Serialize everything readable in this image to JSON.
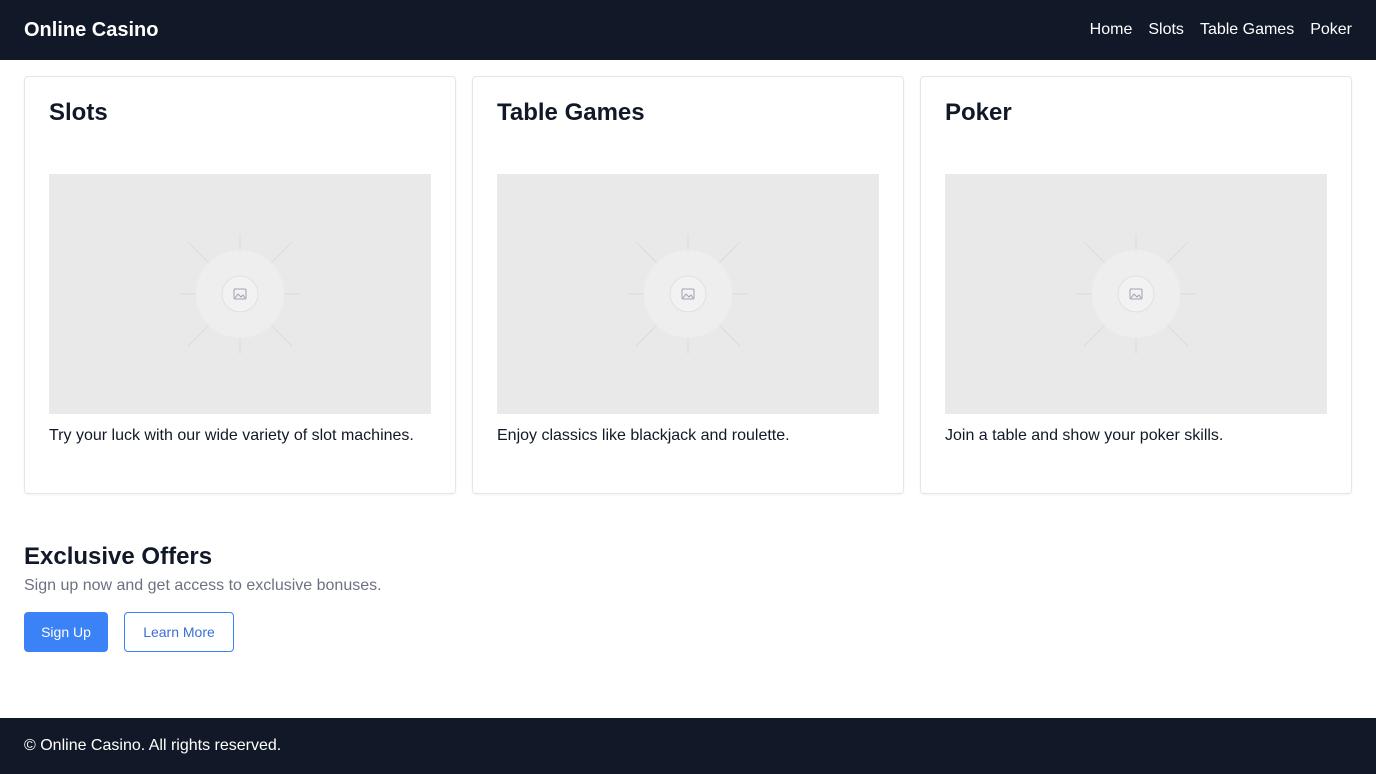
{
  "header": {
    "brand": "Online Casino",
    "nav": [
      "Home",
      "Slots",
      "Table Games",
      "Poker"
    ]
  },
  "cards": [
    {
      "title": "Slots",
      "description": "Try your luck with our wide variety of slot machines.",
      "image_icon": "image-placeholder-icon"
    },
    {
      "title": "Table Games",
      "description": "Enjoy classics like blackjack and roulette.",
      "image_icon": "image-placeholder-icon"
    },
    {
      "title": "Poker",
      "description": "Join a table and show your poker skills.",
      "image_icon": "image-placeholder-icon"
    }
  ],
  "offers": {
    "title": "Exclusive Offers",
    "subtitle": "Sign up now and get access to exclusive bonuses.",
    "signup_label": "Sign Up",
    "learn_label": "Learn More"
  },
  "footer": {
    "text": "© Online Casino. All rights reserved."
  },
  "colors": {
    "header_bg": "#111827",
    "accent": "#3b82f6",
    "placeholder_bg": "#e9e9e9"
  }
}
